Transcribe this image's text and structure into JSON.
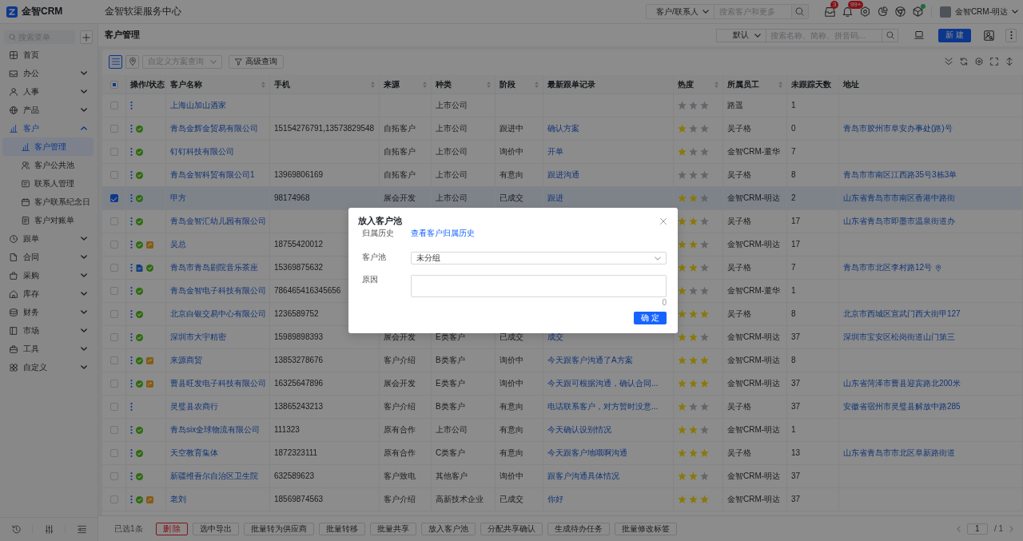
{
  "app": {
    "logo_text": "金智CRM",
    "title": "金智软渠服务中心"
  },
  "header": {
    "search_scope": "客户/联系人",
    "search_placeholder": "搜索客户和更多",
    "message_badge": "3",
    "notice_badge": "99+",
    "update_dot": true,
    "user_name": "金智CRM-明达"
  },
  "sidebar": {
    "search_placeholder": "搜索菜单",
    "items": [
      {
        "label": "首页",
        "selected": false
      },
      {
        "label": "办公",
        "selected": false,
        "expanded": false
      },
      {
        "label": "人事",
        "selected": false,
        "expanded": false
      },
      {
        "label": "产品",
        "selected": false,
        "expanded": false
      },
      {
        "label": "客户",
        "selected": true,
        "expanded": true,
        "children": [
          {
            "label": "客户管理",
            "selected": true
          },
          {
            "label": "客户公共池",
            "selected": false
          },
          {
            "label": "联系人管理",
            "selected": false
          },
          {
            "label": "客户联系纪念日",
            "selected": false
          },
          {
            "label": "客户对账单",
            "selected": false
          }
        ]
      },
      {
        "label": "跟单",
        "selected": false,
        "expanded": false
      },
      {
        "label": "合同",
        "selected": false,
        "expanded": false
      },
      {
        "label": "采购",
        "selected": false,
        "expanded": false
      },
      {
        "label": "库存",
        "selected": false,
        "expanded": false
      },
      {
        "label": "财务",
        "selected": false,
        "expanded": false
      },
      {
        "label": "市场",
        "selected": false,
        "expanded": false
      },
      {
        "label": "工具",
        "selected": false,
        "expanded": false
      },
      {
        "label": "自定义",
        "selected": false,
        "expanded": false
      }
    ]
  },
  "page": {
    "title": "客户管理",
    "view_select": "默认",
    "search_placeholder": "搜索名称、简称、拼音码...",
    "new_button": "新 建"
  },
  "toolbar": {
    "view_modes": [
      {
        "selected": true
      },
      {
        "selected": false
      }
    ],
    "scheme_placeholder": "自定义方案查询",
    "advanced_query": "高级查询"
  },
  "table": {
    "select_all": {
      "indeterminate": true
    },
    "columns": [
      {
        "label": "操作/状态"
      },
      {
        "label": "客户名称",
        "sortable": true
      },
      {
        "label": "手机",
        "sortable": true
      },
      {
        "label": "来源",
        "sortable": true
      },
      {
        "label": "种类",
        "sortable": true
      },
      {
        "label": "阶段",
        "sortable": true
      },
      {
        "label": "最新跟单记录"
      },
      {
        "label": "热度",
        "sortable": true
      },
      {
        "label": "所属员工",
        "sortable": true
      },
      {
        "label": "未跟踪天数"
      },
      {
        "label": "地址"
      }
    ],
    "rows": [
      {
        "selected": false,
        "name": "上海山加山酒家",
        "type": "上市公司",
        "stars": 0,
        "owner": "路遥",
        "days": "1"
      },
      {
        "selected": false,
        "status": [
          {
            "kind": "approved"
          }
        ],
        "name": "青岛金辉金贸易有限公司",
        "phone": "15154276791,13573829548",
        "source": "自拓客户",
        "type": "上市公司",
        "stage": "跟进中",
        "last_follow": "确认方案",
        "stars": 1,
        "owner": "吴子格",
        "days": "0",
        "address": "青岛市胶州市阜安办事处(路)号"
      },
      {
        "selected": false,
        "status": [
          {
            "kind": "approved"
          }
        ],
        "name": "钉钉科技有限公司",
        "source": "自拓客户",
        "type": "上市公司",
        "stage": "询价中",
        "last_follow": "开单",
        "stars": 1,
        "owner": "金智CRM-董华",
        "days": "7"
      },
      {
        "selected": false,
        "status": [
          {
            "kind": "approved"
          }
        ],
        "name": "青岛金智科贸有限公司1",
        "phone": "13969806169",
        "source": "自拓客户",
        "type": "上市公司",
        "stage": "有意向",
        "last_follow": "跟进沟通",
        "stars": 0,
        "owner": "吴子格",
        "days": "8",
        "address": "青岛市市南区江西路35号3栋3单"
      },
      {
        "selected": true,
        "status": [
          {
            "kind": "approved"
          }
        ],
        "name": "甲方",
        "phone": "98174968",
        "source": "展会开发",
        "type": "上市公司",
        "stage": "已成交",
        "last_follow": "跟进",
        "stars": 2,
        "owner": "金智CRM-明达",
        "days": "2",
        "address": "山东省青岛市市南区香港中路街"
      },
      {
        "selected": false,
        "status": [
          {
            "kind": "approved"
          }
        ],
        "name": "青岛金智汇幼儿园有限公司",
        "stars": 2,
        "owner": "吴子格",
        "days": "17",
        "address": "山东省青岛市即墨市温泉街道办"
      },
      {
        "selected": false,
        "status": [
          {
            "kind": "approved"
          },
          {
            "kind": "shared"
          }
        ],
        "name": "吴总",
        "phone": "18755420012",
        "stars": 2,
        "owner": "金智CRM-明达",
        "days": "17"
      },
      {
        "selected": false,
        "located": true,
        "status": [
          {
            "kind": "attached"
          },
          {
            "kind": "approved"
          }
        ],
        "name": "青岛市青岛剧院音乐茶座",
        "phone": "15369875632",
        "stars": 2,
        "owner": "吴子格",
        "days": "7",
        "address": "青岛市市北区李村路12号"
      },
      {
        "selected": false,
        "status": [
          {
            "kind": "approved"
          }
        ],
        "name": "青岛金智电子科技有限公司",
        "phone": "786465416345656",
        "stars": 1,
        "owner": "金智CRM-董华",
        "days": "1"
      },
      {
        "selected": false,
        "status": [
          {
            "kind": "approved"
          }
        ],
        "name": "北京白银交易中心有限公司",
        "phone": "1236589752",
        "stars": 3,
        "owner": "吴子格",
        "days": "8",
        "address": "北京市西城区宣武门西大街甲127"
      },
      {
        "selected": false,
        "status": [
          {
            "kind": "approved"
          }
        ],
        "name": "深圳市大宇精密",
        "phone": "15989898393",
        "source": "展会开发",
        "type": "E类客户",
        "stage": "已成交",
        "last_follow": "成交",
        "stars": 2,
        "owner": "金智CRM-明达",
        "days": "37",
        "address": "深圳市宝安区松岗街道山门第三"
      },
      {
        "selected": false,
        "status": [
          {
            "kind": "approved"
          },
          {
            "kind": "shared"
          }
        ],
        "name": "来源商贸",
        "phone": "13853278676",
        "source": "客户介绍",
        "type": "B类客户",
        "stage": "询价中",
        "last_follow": "今天跟客户沟通了A方案",
        "stars": 3,
        "owner": "金智CRM-明达",
        "days": "8"
      },
      {
        "selected": false,
        "status": [
          {
            "kind": "approved"
          },
          {
            "kind": "shared"
          }
        ],
        "name": "曹县旺发电子科技有限公司",
        "phone": "16325647896",
        "source": "展会开发",
        "type": "E类客户",
        "stage": "询价中",
        "last_follow": "今天跟可根据沟通，确认合同...",
        "stars": 3,
        "owner": "金智CRM-明达",
        "days": "37",
        "address": "山东省菏泽市曹县迎宾路北200米"
      },
      {
        "selected": false,
        "name": "灵璧县农商行",
        "phone": "13865243213",
        "source": "客户介绍",
        "type": "B类客户",
        "stage": "有意向",
        "last_follow": "电话联系客户，对方暂时没意...",
        "stars": 1,
        "owner": "吴子格",
        "days": "37",
        "address": "安徽省宿州市灵璧县解放中路285"
      },
      {
        "selected": false,
        "status": [
          {
            "kind": "approved"
          }
        ],
        "name": "青岛six全球物流有限公司",
        "phone": "111323",
        "source": "原有合作",
        "type": "上市公司",
        "stage": "有意向",
        "last_follow": "今天确认设别情况",
        "stars": 2,
        "owner": "金智CRM-明达",
        "days": "1"
      },
      {
        "selected": false,
        "status": [
          {
            "kind": "approved"
          }
        ],
        "name": "天空教育集体",
        "phone": "1872323111",
        "source": "原有合作",
        "type": "C类客户",
        "stage": "有意向",
        "last_follow": "今天跟客户地哦啊沟通",
        "stars": 3,
        "owner": "吴子格",
        "days": "13",
        "address": "山东省青岛市市北区阜新路街道"
      },
      {
        "selected": false,
        "status": [
          {
            "kind": "approved"
          }
        ],
        "name": "新疆维吾尔自治区卫生院",
        "phone": "632589623",
        "source": "客户致电",
        "type": "其他客户",
        "stage": "询价中",
        "last_follow": "跟客户沟通具体情况",
        "stars": 2,
        "owner": "金智CRM-明达",
        "days": "37"
      },
      {
        "selected": false,
        "status": [
          {
            "kind": "approved"
          },
          {
            "kind": "shared"
          }
        ],
        "name": "老刘",
        "phone": "18569874563",
        "source": "客户介绍",
        "type": "高新技术企业",
        "stage": "已成交",
        "last_follow": "你好",
        "stars": 3,
        "owner": "金智CRM-明达",
        "days": "37"
      }
    ]
  },
  "bulk_bar": {
    "selected_count": "已选1条",
    "actions": [
      {
        "label": "删 除",
        "kind": "danger"
      },
      {
        "label": "选中导出",
        "kind": "default"
      },
      {
        "label": "批量转为供应商",
        "kind": "default"
      },
      {
        "label": "批量转移",
        "kind": "default"
      },
      {
        "label": "批量共享",
        "kind": "default"
      },
      {
        "label": "放入客户池",
        "kind": "default"
      },
      {
        "label": "分配共享确认",
        "kind": "default"
      },
      {
        "label": "生成待办任务",
        "kind": "default"
      },
      {
        "label": "批量修改标签",
        "kind": "default"
      }
    ]
  },
  "pagination": {
    "page": "1",
    "total": "/ 1"
  },
  "modal": {
    "title": "放入客户池",
    "fields": [
      {
        "kind": "link",
        "label": "归属历史",
        "value": "查看客户归属历史"
      },
      {
        "kind": "select",
        "label": "客户池",
        "value": "未分组"
      },
      {
        "kind": "textarea",
        "label": "原因",
        "counter": "0"
      }
    ],
    "confirm": "确 定"
  }
}
